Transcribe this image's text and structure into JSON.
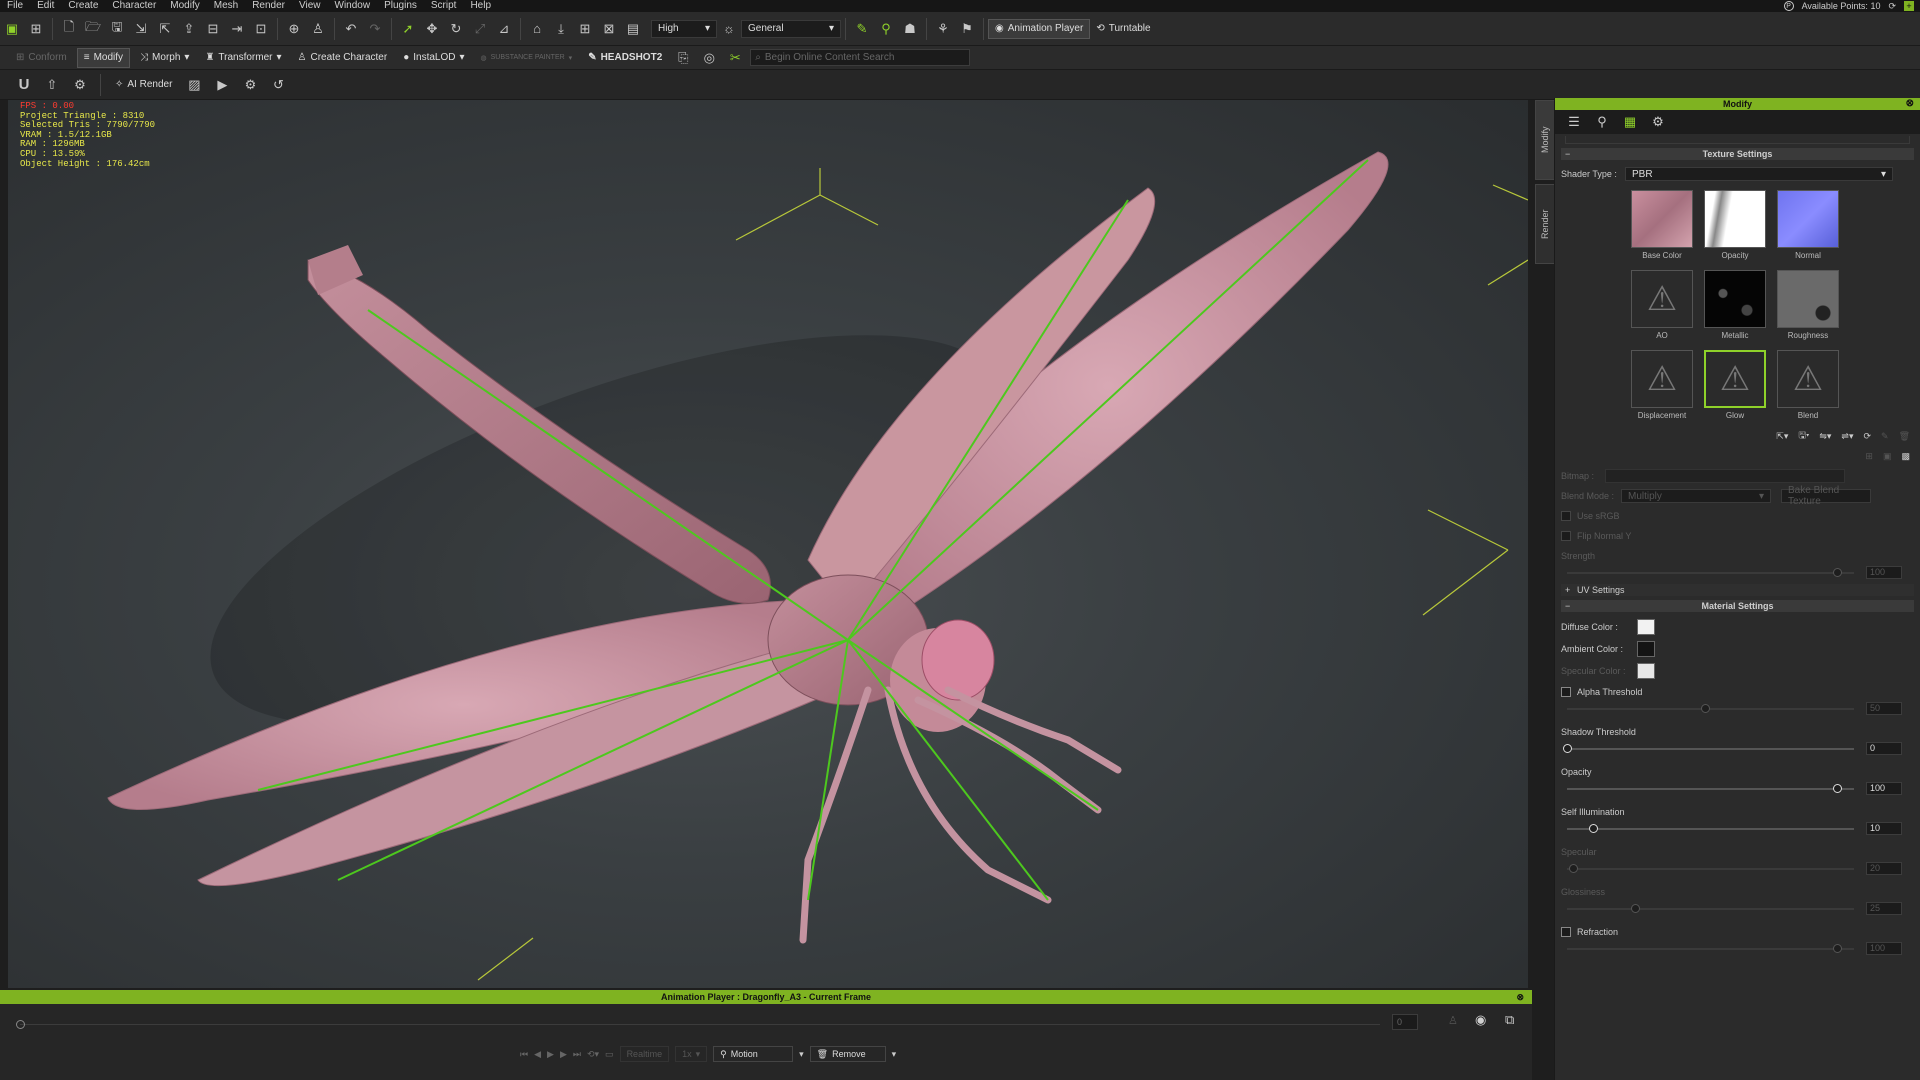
{
  "menu": {
    "items": [
      "File",
      "Edit",
      "Create",
      "Character",
      "Modify",
      "Mesh",
      "Render",
      "View",
      "Window",
      "Plugins",
      "Script",
      "Help"
    ],
    "available_points": "Available Points: 10"
  },
  "toolbar": {
    "quality": "High",
    "camera": "General",
    "animation_player_label": "Animation Player",
    "turntable_label": "Turntable"
  },
  "toolbar2": {
    "conform": "Conform",
    "modify": "Modify",
    "morph": "Morph",
    "transformer": "Transformer",
    "create_character": "Create Character",
    "instalod": "InstaLOD",
    "substance": "SUBSTANCE PAINTER",
    "headshot": "HEADSHOT2",
    "search_placeholder": "Begin Online Content Search"
  },
  "toolbar3": {
    "ai_render": "AI Render",
    "u_label": "U"
  },
  "stats": {
    "fps": "FPS : 0.00",
    "project_triangle": "Project Triangle : 8310",
    "selected_tris": "Selected Tris : 7790/7790",
    "vram": "VRAM : 1.5/12.1GB",
    "ram": "RAM : 1296MB",
    "cpu": "CPU : 13.59%",
    "object_height": "Object Height : 176.42cm"
  },
  "sidetabs": [
    "Modify",
    "Render"
  ],
  "panel": {
    "title": "Modify",
    "texture_settings": "Texture Settings",
    "shader_type_label": "Shader Type :",
    "shader_type_value": "PBR",
    "textures": [
      {
        "label": "Base Color",
        "icon": "base-color-thumbnail"
      },
      {
        "label": "Opacity",
        "icon": "opacity-thumbnail"
      },
      {
        "label": "Normal",
        "icon": "normal-thumbnail"
      },
      {
        "label": "AO",
        "icon": "warning-icon"
      },
      {
        "label": "Metallic",
        "icon": "metallic-thumbnail"
      },
      {
        "label": "Roughness",
        "icon": "roughness-thumbnail"
      },
      {
        "label": "Displacement",
        "icon": "warning-icon"
      },
      {
        "label": "Glow",
        "icon": "warning-icon"
      },
      {
        "label": "Blend",
        "icon": "warning-icon"
      }
    ],
    "bitmap_label": "Bitmap :",
    "blend_mode_label": "Blend Mode :",
    "blend_mode_value": "Multiply",
    "bake_blend_label": "Bake Blend Texture",
    "use_srgb": "Use sRGB",
    "flip_normal": "Flip Normal Y",
    "strength_label": "Strength",
    "strength_value": "100",
    "uv_settings": "UV Settings",
    "material_settings": "Material Settings",
    "diffuse_label": "Diffuse Color :",
    "ambient_label": "Ambient Color :",
    "specular_color_label": "Specular Color :",
    "alpha_threshold": "Alpha Threshold",
    "alpha_value": "50",
    "shadow_threshold": "Shadow Threshold",
    "shadow_value": "0",
    "opacity_label": "Opacity",
    "opacity_value": "100",
    "self_illum_label": "Self Illumination",
    "self_illum_value": "10",
    "specular_label": "Specular",
    "specular_value": "20",
    "glossiness_label": "Glossiness",
    "glossiness_value": "25",
    "refraction_label": "Refraction",
    "refraction_value": "100",
    "colors": {
      "diffuse": "#f2f2f2",
      "ambient": "#141414",
      "specular": "#e8e8e8"
    }
  },
  "anim": {
    "title": "Animation Player : Dragonfly_A3 - Current Frame",
    "frame": "0",
    "realtime": "Realtime",
    "speed": "1x",
    "motion": "Motion",
    "remove": "Remove"
  }
}
